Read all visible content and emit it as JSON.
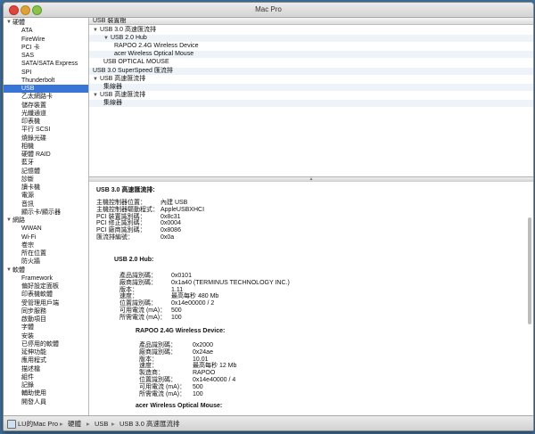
{
  "window": {
    "title": "Mac Pro"
  },
  "sidebar": {
    "items": [
      {
        "label": "硬體",
        "kind": "cat"
      },
      {
        "label": "ATA",
        "kind": "item"
      },
      {
        "label": "FireWire",
        "kind": "item"
      },
      {
        "label": "PCI 卡",
        "kind": "item"
      },
      {
        "label": "SAS",
        "kind": "item"
      },
      {
        "label": "SATA/SATA Express",
        "kind": "item"
      },
      {
        "label": "SPI",
        "kind": "item"
      },
      {
        "label": "Thunderbolt",
        "kind": "item"
      },
      {
        "label": "USB",
        "kind": "item",
        "selected": true
      },
      {
        "label": "乙太網路卡",
        "kind": "item"
      },
      {
        "label": "儲存裝置",
        "kind": "item"
      },
      {
        "label": "光纖通道",
        "kind": "item"
      },
      {
        "label": "印表機",
        "kind": "item"
      },
      {
        "label": "平行 SCSI",
        "kind": "item"
      },
      {
        "label": "燒錄光碟",
        "kind": "item"
      },
      {
        "label": "相機",
        "kind": "item"
      },
      {
        "label": "硬體 RAID",
        "kind": "item"
      },
      {
        "label": "藍牙",
        "kind": "item"
      },
      {
        "label": "記憶體",
        "kind": "item"
      },
      {
        "label": "診斷",
        "kind": "item"
      },
      {
        "label": "讀卡機",
        "kind": "item"
      },
      {
        "label": "電源",
        "kind": "item"
      },
      {
        "label": "音訊",
        "kind": "item"
      },
      {
        "label": "顯示卡/顯示器",
        "kind": "item"
      },
      {
        "label": "網路",
        "kind": "cat"
      },
      {
        "label": "WWAN",
        "kind": "item"
      },
      {
        "label": "Wi-Fi",
        "kind": "item"
      },
      {
        "label": "卷宗",
        "kind": "item"
      },
      {
        "label": "所在位置",
        "kind": "item"
      },
      {
        "label": "防火牆",
        "kind": "item"
      },
      {
        "label": "軟體",
        "kind": "cat"
      },
      {
        "label": "Framework",
        "kind": "item"
      },
      {
        "label": "偏好設定面板",
        "kind": "item"
      },
      {
        "label": "印表機軟體",
        "kind": "item"
      },
      {
        "label": "受管理用戶端",
        "kind": "item"
      },
      {
        "label": "同步服務",
        "kind": "item"
      },
      {
        "label": "啟動項目",
        "kind": "item"
      },
      {
        "label": "字體",
        "kind": "item"
      },
      {
        "label": "安裝",
        "kind": "item"
      },
      {
        "label": "已停用的軟體",
        "kind": "item"
      },
      {
        "label": "延伸功能",
        "kind": "item"
      },
      {
        "label": "應用程式",
        "kind": "item"
      },
      {
        "label": "描述檔",
        "kind": "item"
      },
      {
        "label": "組件",
        "kind": "item"
      },
      {
        "label": "記錄",
        "kind": "item"
      },
      {
        "label": "輔助使用",
        "kind": "item"
      },
      {
        "label": "開發人員",
        "kind": "item"
      }
    ]
  },
  "tree": {
    "header": "USB 裝置樹",
    "rows": [
      {
        "label": "USB 3.0 高速匯流排",
        "level": 0,
        "arrow": "▼"
      },
      {
        "label": "USB 2.0 Hub",
        "level": 1,
        "arrow": "▼"
      },
      {
        "label": "RAPOO 2.4G Wireless Device",
        "level": 2,
        "arrow": ""
      },
      {
        "label": "acer Wireless Optical Mouse",
        "level": 2,
        "arrow": ""
      },
      {
        "label": "USB OPTICAL MOUSE",
        "level": 1,
        "arrow": ""
      },
      {
        "label": "USB 3.0 SuperSpeed 匯流排",
        "level": 0,
        "arrow": ""
      },
      {
        "label": "USB 高速匯流排",
        "level": 0,
        "arrow": "▼"
      },
      {
        "label": "集線器",
        "level": 1,
        "arrow": ""
      },
      {
        "label": "USB 高速匯流排",
        "level": 0,
        "arrow": "▼"
      },
      {
        "label": "集線器",
        "level": 1,
        "arrow": ""
      }
    ]
  },
  "detail": {
    "title": "USB 3.0 高速匯流排:",
    "bus": [
      {
        "k": "主機控制器位置：",
        "v": "內建 USB"
      },
      {
        "k": "主機控制器驅動程式：",
        "v": "AppleUSBXHCI"
      },
      {
        "k": "PCI 裝置識別碼：",
        "v": "0x8c31"
      },
      {
        "k": "PCI 修正識別碼：",
        "v": "0x0004"
      },
      {
        "k": "PCI 廠商識別碼：",
        "v": "0x8086"
      },
      {
        "k": "匯流排編號：",
        "v": "0x0a"
      }
    ],
    "hub": {
      "name": "USB 2.0 Hub:",
      "props": [
        {
          "k": "產品識別碼：",
          "v": "0x0101"
        },
        {
          "k": "廠商識別碼：",
          "v": "0x1a40  (TERMINUS TECHNOLOGY INC.)"
        },
        {
          "k": "版本：",
          "v": "1.11"
        },
        {
          "k": "速度：",
          "v": "最高每秒 480 Mb"
        },
        {
          "k": "位置識別碼：",
          "v": "0x14e00000 / 2"
        },
        {
          "k": "可用電流 (mA)：",
          "v": "500"
        },
        {
          "k": "所需電流 (mA)：",
          "v": "100"
        }
      ]
    },
    "dev1": {
      "name": "RAPOO 2.4G Wireless Device:",
      "props": [
        {
          "k": "產品識別碼：",
          "v": "0x2000"
        },
        {
          "k": "廠商識別碼：",
          "v": "0x24ae"
        },
        {
          "k": "版本：",
          "v": "10.01"
        },
        {
          "k": "速度：",
          "v": "最高每秒 12 Mb"
        },
        {
          "k": "製造商：",
          "v": "RAPOO"
        },
        {
          "k": "位置識別碼：",
          "v": "0x14e40000 / 4"
        },
        {
          "k": "可用電流 (mA)：",
          "v": "500"
        },
        {
          "k": "所需電流 (mA)：",
          "v": "100"
        }
      ]
    },
    "dev2": {
      "name": "acer Wireless Optical Mouse:",
      "props": [
        {
          "k": "產品識別碼：",
          "v": "0x4dc6"
        },
        {
          "k": "廠商識別碼：",
          "v": "0x0461  (Primax Electronics)"
        },
        {
          "k": "版本：",
          "v": "1.00"
        }
      ]
    }
  },
  "statusbar": {
    "crumbs": [
      "LU的Mac Pro",
      "硬體",
      "USB",
      "USB 3.0 高速匯流排"
    ],
    "separator": "▸"
  }
}
